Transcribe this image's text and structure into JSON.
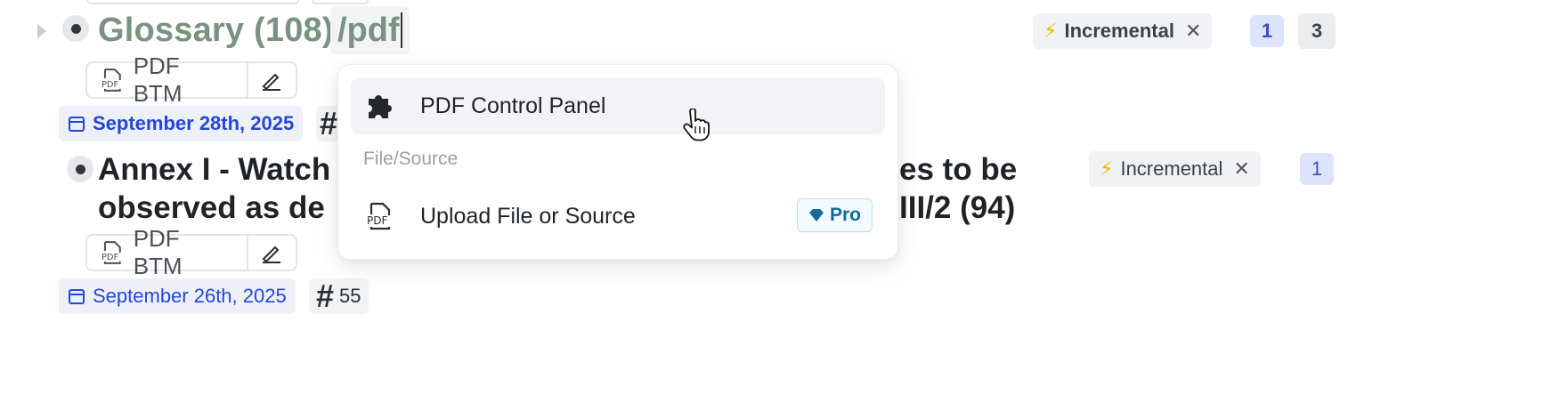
{
  "block1": {
    "title": "Glossary (108)",
    "slash_command": "/pdf",
    "tag_label": "Incremental",
    "count_a": "1",
    "count_b": "3",
    "pdf_button_label": "PDF BTM",
    "date": "September 28th, 2025"
  },
  "block2": {
    "title_line1": "Annex I - Watch",
    "title_line1_right": "es to be",
    "title_line2": "observed as de",
    "title_line2_right": "III/2 (94)",
    "tag_label": "Incremental",
    "count_a": "1",
    "pdf_button_label": "PDF BTM",
    "date": "September 26th, 2025",
    "hash_value": "55"
  },
  "dropdown": {
    "items": [
      {
        "label": "PDF Control Panel",
        "icon": "puzzle-icon"
      },
      {
        "label": "Upload File or Source",
        "icon": "pdf-file-icon",
        "badge": "Pro"
      }
    ],
    "section_label": "File/Source"
  },
  "colors": {
    "date_blue": "#2447d9",
    "title_green": "#7a9280",
    "bolt_yellow": "#f3b400",
    "count_blue_bg": "#dde3fb"
  }
}
